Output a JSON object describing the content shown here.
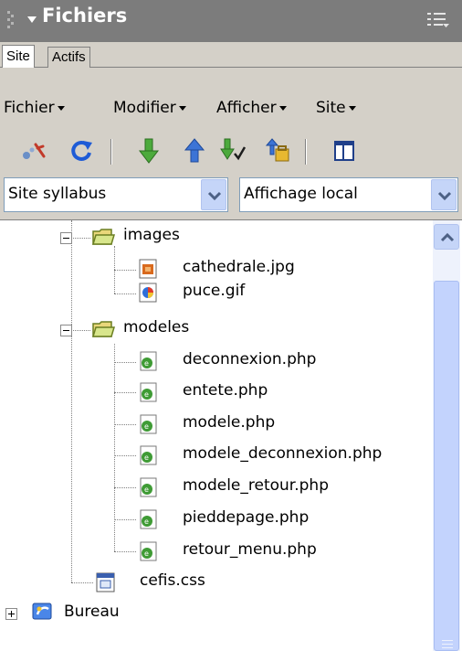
{
  "panel": {
    "title": "Fichiers"
  },
  "tabs": [
    {
      "label": "Site",
      "active": true
    },
    {
      "label": "Actifs",
      "active": false
    }
  ],
  "menubar": {
    "items": [
      "Fichier",
      "Modifier",
      "Afficher",
      "Site"
    ]
  },
  "toolbar": {
    "icons": [
      "connect-icon",
      "refresh-icon",
      "get-icon",
      "put-icon",
      "check-out-icon",
      "check-in-icon",
      "expand-icon"
    ]
  },
  "selectors": {
    "site": {
      "value": "Site syllabus"
    },
    "view": {
      "value": "Affichage local"
    }
  },
  "tree": {
    "items": [
      {
        "label": "images",
        "type": "folder",
        "expanded": true
      },
      {
        "label": "cathedrale.jpg",
        "type": "image-jpg"
      },
      {
        "label": "puce.gif",
        "type": "image-gif"
      },
      {
        "label": "modeles",
        "type": "folder",
        "expanded": true
      },
      {
        "label": "deconnexion.php",
        "type": "php"
      },
      {
        "label": "entete.php",
        "type": "php"
      },
      {
        "label": "modele.php",
        "type": "php"
      },
      {
        "label": "modele_deconnexion.php",
        "type": "php"
      },
      {
        "label": "modele_retour.php",
        "type": "php"
      },
      {
        "label": "pieddepage.php",
        "type": "php"
      },
      {
        "label": "retour_menu.php",
        "type": "php"
      },
      {
        "label": "cefis.css",
        "type": "css"
      },
      {
        "label": "Bureau",
        "type": "desktop",
        "expanded": false
      }
    ]
  },
  "colors": {
    "titlebar": "#7c7c7c",
    "chrome": "#d4d0c8",
    "scrollbar_accent": "#c5d5f8"
  }
}
